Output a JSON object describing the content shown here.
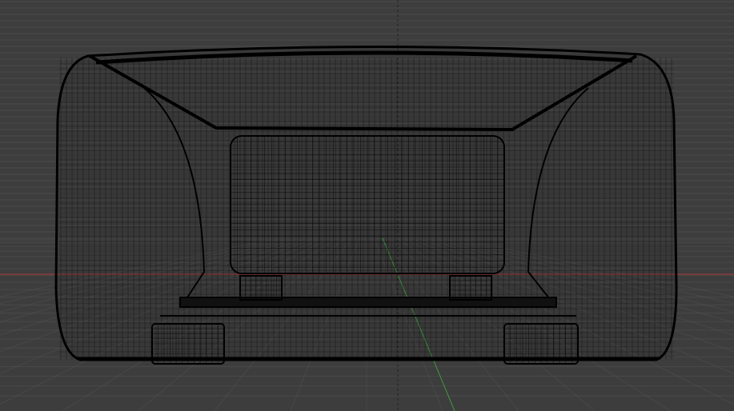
{
  "viewport": {
    "background": "#3d3d3d",
    "grid_line_color": "#555555",
    "axis_x_color": "#9c3a3a",
    "axis_y_color": "#3f9a3f",
    "axis_z_color": "#222222",
    "wire_color": "#000000"
  },
  "object": {
    "shape": "couch-wireframe",
    "view": "front-orthographic"
  }
}
